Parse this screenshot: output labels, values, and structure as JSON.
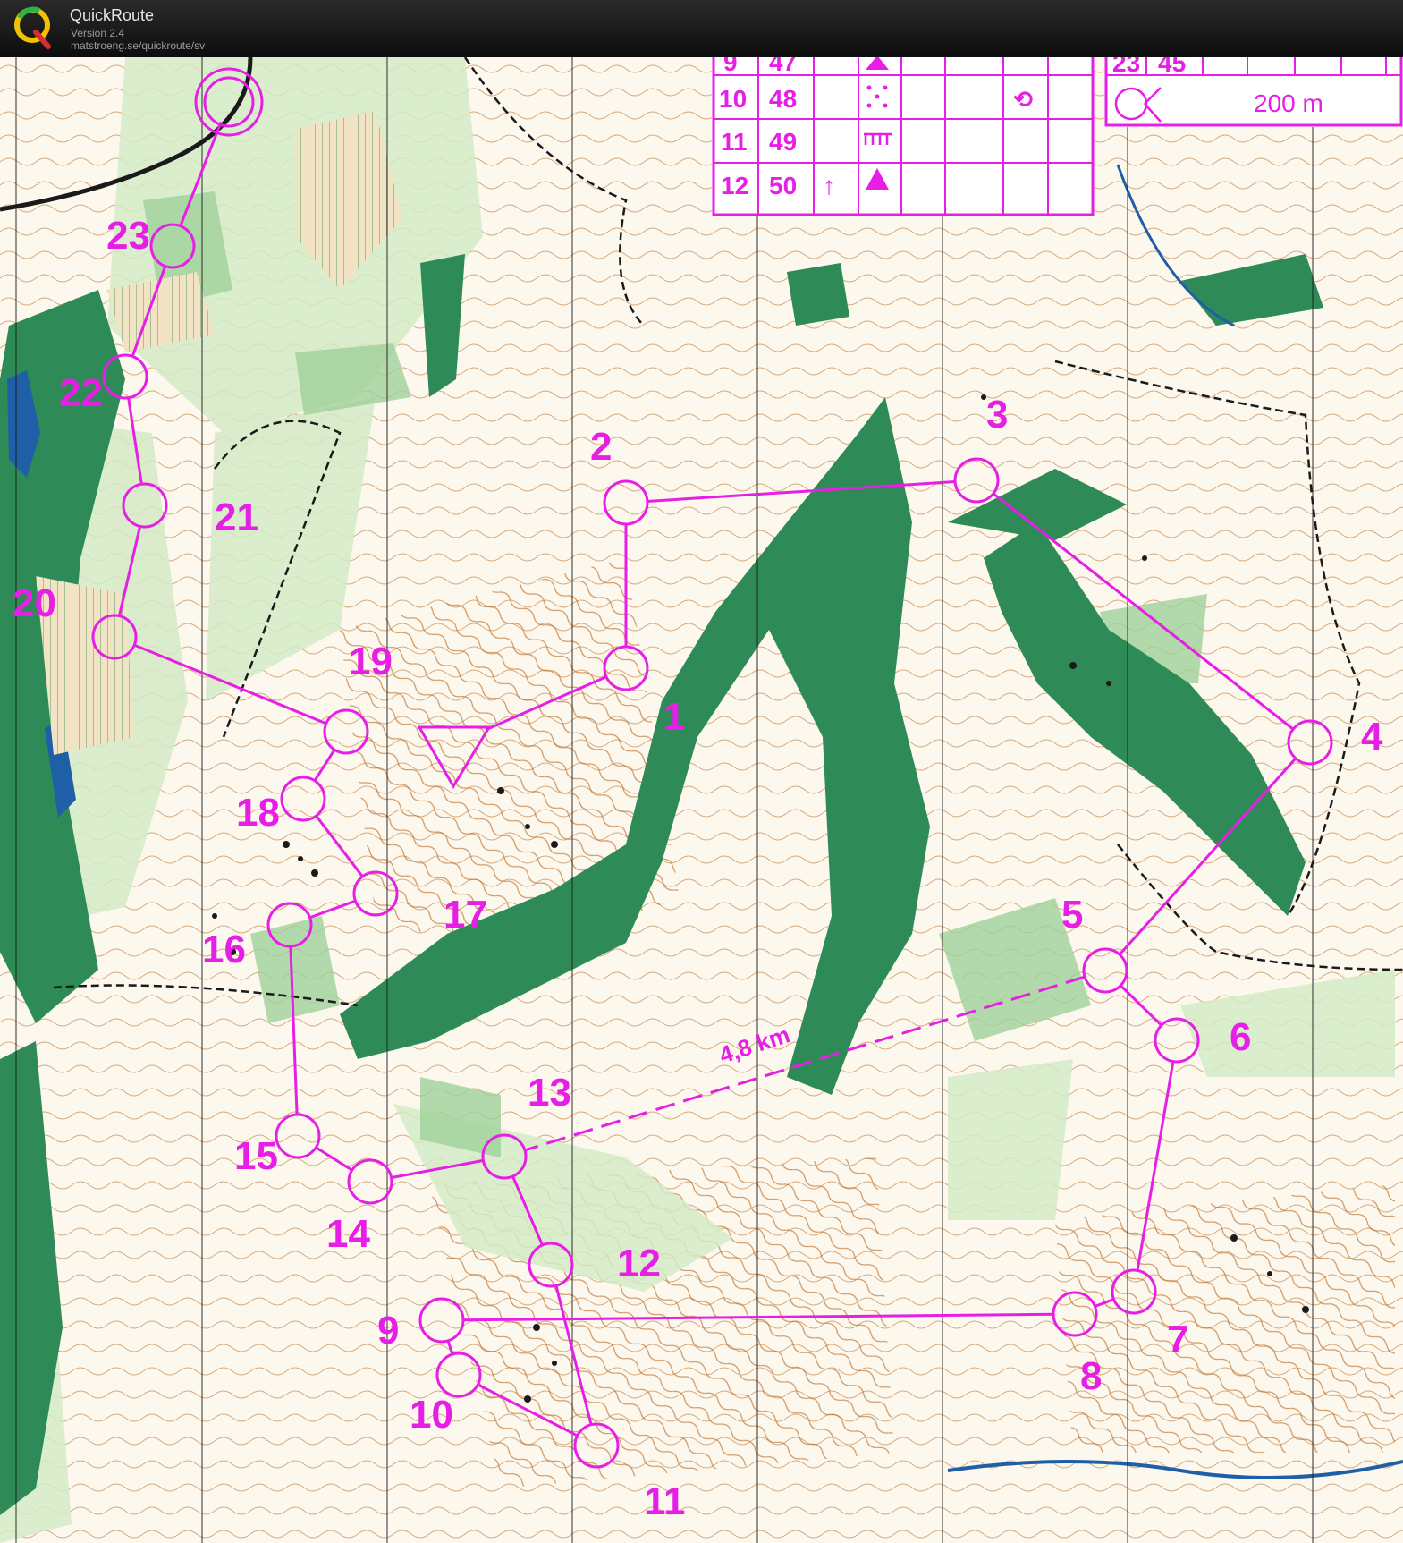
{
  "app": {
    "name": "QuickRoute",
    "version": "Version 2.4",
    "url": "matstroeng.se/quickroute/sv"
  },
  "colors": {
    "overprint": "#e61ee6",
    "paper": "#fdf8ee",
    "open_land": "#f7d7a8",
    "light_green": "#d4ebc6",
    "mid_green": "#9fd19a",
    "dark_green": "#2e8b57",
    "contour": "#b5651d",
    "water": "#1e5fa8",
    "track": "#1a1a1a"
  },
  "description_table": {
    "rows": [
      {
        "ctl": "9",
        "code": "47",
        "sym": "triangle"
      },
      {
        "ctl": "10",
        "code": "48",
        "sym": "dots"
      },
      {
        "ctl": "11",
        "code": "49",
        "sym": "comb"
      },
      {
        "ctl": "12",
        "code": "50",
        "sym": "triangle"
      }
    ],
    "row10_extra": "⟲",
    "row12_arrow": "↑"
  },
  "legend_box": {
    "partial_row": {
      "ctl": "23",
      "code": "45"
    },
    "distance": "200 m"
  },
  "course": {
    "start_label": "",
    "leg_distance_label": "4,8 km",
    "controls": [
      {
        "n": "1"
      },
      {
        "n": "2"
      },
      {
        "n": "3"
      },
      {
        "n": "4"
      },
      {
        "n": "5"
      },
      {
        "n": "6"
      },
      {
        "n": "7"
      },
      {
        "n": "8"
      },
      {
        "n": "9"
      },
      {
        "n": "10"
      },
      {
        "n": "11"
      },
      {
        "n": "12"
      },
      {
        "n": "13"
      },
      {
        "n": "14"
      },
      {
        "n": "15"
      },
      {
        "n": "16"
      },
      {
        "n": "17"
      },
      {
        "n": "18"
      },
      {
        "n": "19"
      },
      {
        "n": "20"
      },
      {
        "n": "21"
      },
      {
        "n": "22"
      },
      {
        "n": "23"
      }
    ]
  }
}
